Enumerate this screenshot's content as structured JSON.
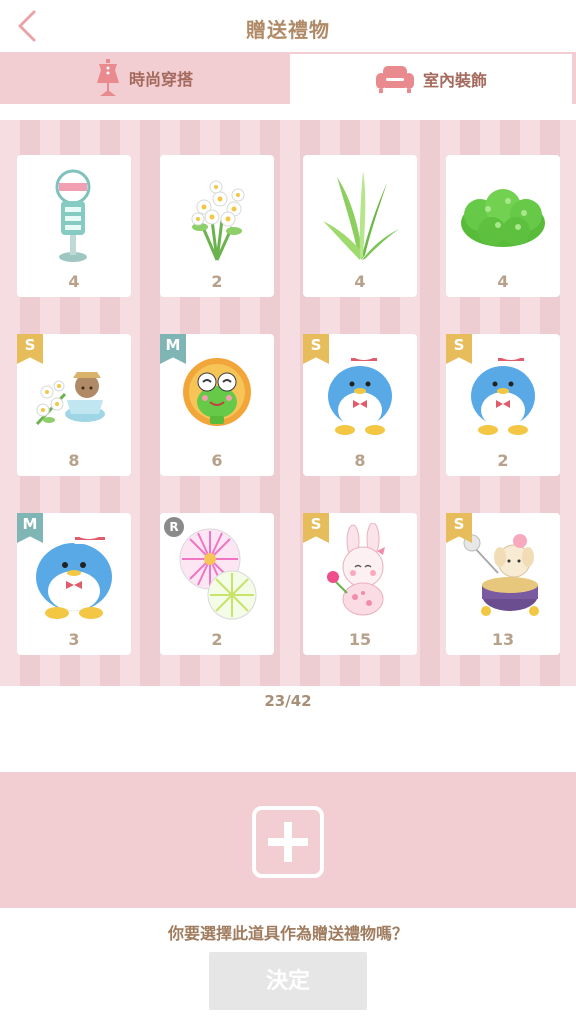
{
  "header": {
    "title": "贈送禮物",
    "back_icon": "chevron-left-icon"
  },
  "tabs": [
    {
      "label": "時尚穿搭",
      "icon": "dress-mannequin-icon",
      "selected": false
    },
    {
      "label": "室內裝飾",
      "icon": "sofa-icon",
      "selected": true
    }
  ],
  "items": [
    {
      "name": "bus-stop-sign",
      "count": "4",
      "badge": ""
    },
    {
      "name": "white-flower-bouquet",
      "count": "2",
      "badge": ""
    },
    {
      "name": "green-plant",
      "count": "4",
      "badge": ""
    },
    {
      "name": "green-bush",
      "count": "4",
      "badge": ""
    },
    {
      "name": "flower-teacup-bear",
      "count": "8",
      "badge": "S"
    },
    {
      "name": "keroppi-sunflower",
      "count": "6",
      "badge": "M"
    },
    {
      "name": "tuxedosam-penguin",
      "count": "8",
      "badge": "S"
    },
    {
      "name": "tuxedosam-penguin",
      "count": "2",
      "badge": "S"
    },
    {
      "name": "tuxedosam-penguin-large",
      "count": "3",
      "badge": "M"
    },
    {
      "name": "fireworks",
      "count": "2",
      "badge": "R"
    },
    {
      "name": "pink-bunny-flower",
      "count": "15",
      "badge": "S"
    },
    {
      "name": "purple-dog-drum",
      "count": "13",
      "badge": "S"
    }
  ],
  "pagination": {
    "text": "23/42"
  },
  "selection": {
    "add_icon": "plus-icon"
  },
  "confirm": {
    "question": "你要選擇此道具作為贈送禮物嗎？",
    "button": "決定"
  },
  "colors": {
    "tab_bar": "#f2cdd2",
    "text_brown": "#b08a66",
    "badge_s": "#e7bd5c",
    "badge_m": "#7fb5b4",
    "badge_r": "#8a8a8a"
  }
}
